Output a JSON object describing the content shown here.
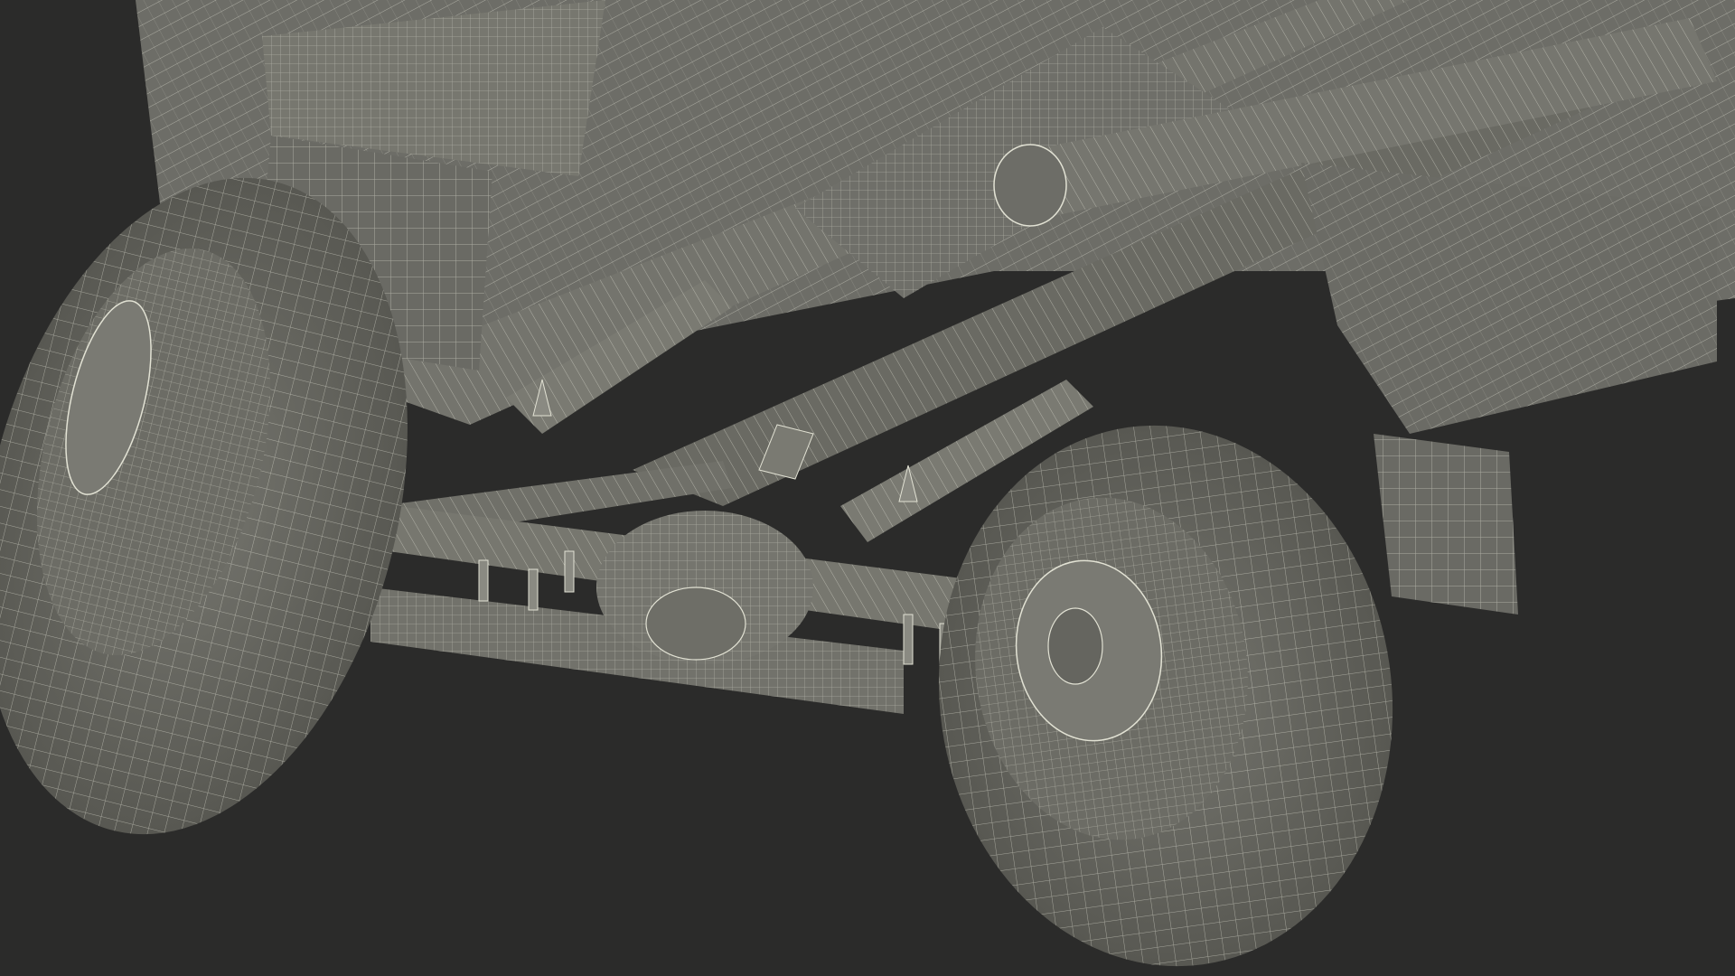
{
  "scene": {
    "background_color": "#2b2b2a",
    "surface_color": "#6d6d67",
    "surface_shadow_color": "#4c4c47",
    "wire_color": "#e2e2d4",
    "tire_color": "#62625c",
    "rim_color": "#7a7a73"
  },
  "objects": [
    "truck-chassis",
    "left-mud-flap",
    "right-mud-flap",
    "front-tire-left",
    "rear-tire-right",
    "rear-axle",
    "differential-housing",
    "leaf-spring-left",
    "leaf-spring-right",
    "exhaust-pipe",
    "fuel-tank",
    "cross-member",
    "u-bolts",
    "shock-absorber"
  ]
}
